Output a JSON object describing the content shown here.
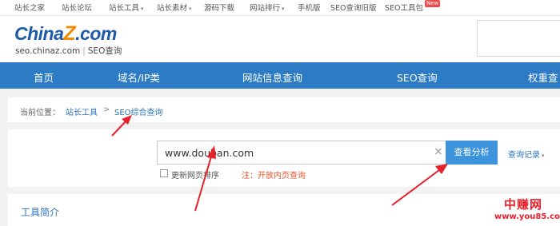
{
  "topbar": {
    "links": [
      {
        "label": "站长之家",
        "caret": false
      },
      {
        "label": "站长论坛",
        "caret": false
      },
      {
        "label": "站长工具",
        "caret": true
      },
      {
        "label": "站长素材",
        "caret": true
      },
      {
        "label": "源码下载",
        "caret": false
      },
      {
        "label": "网站排行",
        "caret": true
      },
      {
        "label": "手机版",
        "caret": false
      },
      {
        "label": "SEO查询旧版",
        "caret": false
      },
      {
        "label": "SEO工具包",
        "caret": false
      }
    ],
    "new_badge": "New"
  },
  "header": {
    "logo_main": "China",
    "logo_z": "Z",
    "logo_com": ".com",
    "logo_domain": "seo.chinaz.com",
    "logo_divider": "|",
    "logo_product": "SEO查询"
  },
  "nav": {
    "items": [
      "首页",
      "域名/IP类",
      "网站信息查询",
      "SEO查询",
      "权重查"
    ]
  },
  "breadcrumb": {
    "prefix": "当前位置：",
    "items": [
      "站长工具",
      "SEO综合查询"
    ],
    "separator": ">"
  },
  "search": {
    "value": "www.douban.com",
    "clear": "×",
    "button": "查看分析",
    "history": "查询记录",
    "option_label": "更新网页排序",
    "option_note": "注：开放内页查询"
  },
  "intro": {
    "title": "工具简介"
  },
  "watermark": {
    "line1": "中赚网",
    "line2": "www.you85.com"
  },
  "colors": {
    "nav_bg": "#2c7bc4",
    "link": "#2a73c0",
    "button": "#3d93dc",
    "note": "#e4532a",
    "arrow": "#e8202a"
  }
}
